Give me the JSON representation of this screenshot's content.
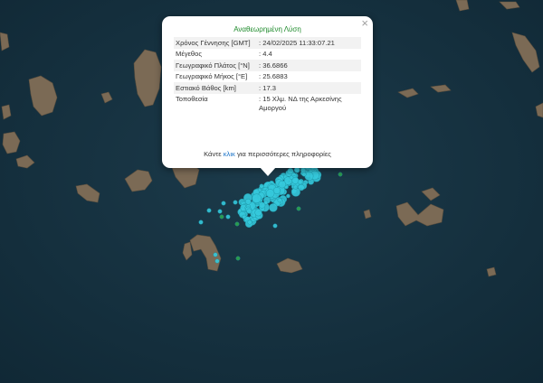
{
  "popup": {
    "title": "Αναθεωρημένη Λύση",
    "rows": [
      {
        "label": "Χρόνος Γέννησης [GMT]",
        "value": ": 24/02/2025 11:33:07.21"
      },
      {
        "label": "Μέγεθος",
        "value": ": 4.4"
      },
      {
        "label": "Γεωγραφικό Πλάτος [°N]",
        "value": ": 36.6866"
      },
      {
        "label": "Γεωγραφικό Μήκος [°E]",
        "value": ": 25.6883"
      },
      {
        "label": "Εστιακό Βάθος [km]",
        "value": ": 17.3"
      },
      {
        "label": "Τοποθεσία",
        "value": ": 15 Χλμ. ΝΔ της Αρκεσίνης Αμοργού"
      }
    ],
    "more_prefix": "Κάντε",
    "more_link": "κλικ",
    "more_suffix": "για περισσότερες πληροφορίες",
    "close_symbol": "×"
  },
  "colors": {
    "sea": "#14303f",
    "land": "#7a6a55",
    "marker_cyan": "#35c9dc",
    "marker_green": "#2fa54c",
    "title_green": "#1f8b2c",
    "link_blue": "#1a73c8"
  }
}
